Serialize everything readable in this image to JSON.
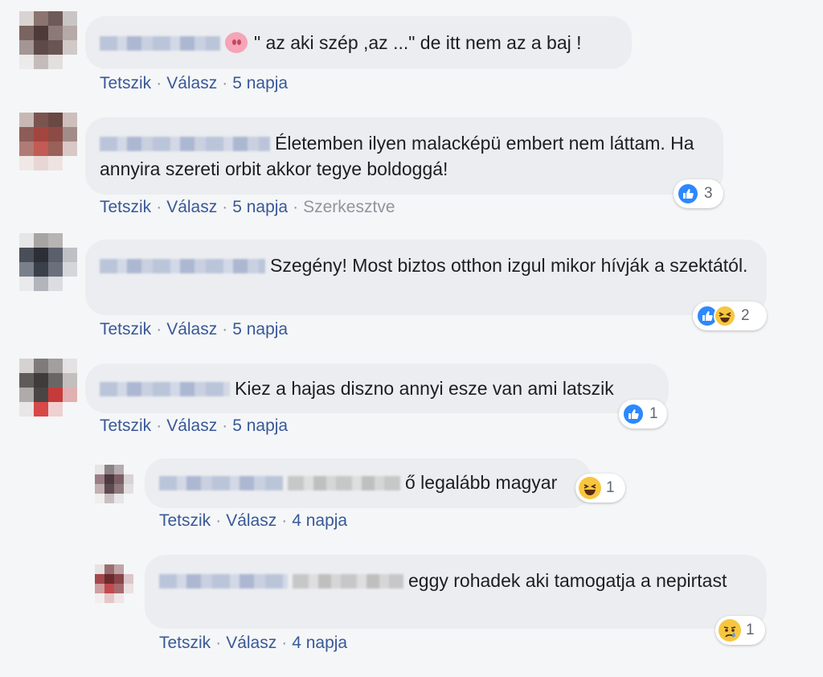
{
  "actions": {
    "like": "Tetszik",
    "reply": "Válasz",
    "separator": "·"
  },
  "comments": [
    {
      "text": "\" az aki szép ,az ...\" de itt nem az a baj !",
      "age": "5 napja"
    },
    {
      "text": "Életemben ilyen malacképü embert nem láttam. Ha annyira szereti orbit akkor tegye boldoggá!",
      "age": "5 napja",
      "edited": "Szerkesztve",
      "reaction_count": "3"
    },
    {
      "text": "Szegény! Most biztos otthon izgul mikor hívják a szektától.",
      "age": "5 napja",
      "reaction_count": "2"
    },
    {
      "text": "Kiez a hajas diszno annyi esze van ami latszik",
      "age": "5 napja",
      "reaction_count": "1"
    },
    {
      "text": "ő legalább magyar",
      "age": "4 napja",
      "reaction_count": "1"
    },
    {
      "text": "eggy rohadek aki tamogatja a nepirtast",
      "age": "4 napja",
      "reaction_count": "1"
    }
  ],
  "colors": {
    "link": "#385898",
    "bubble": "#ebedf0",
    "like_blue": "#2d88ff",
    "emoji_yellow": "#f7c640"
  },
  "icons": [
    "pig-emoji-icon",
    "like-icon",
    "haha-icon",
    "sad-icon"
  ]
}
